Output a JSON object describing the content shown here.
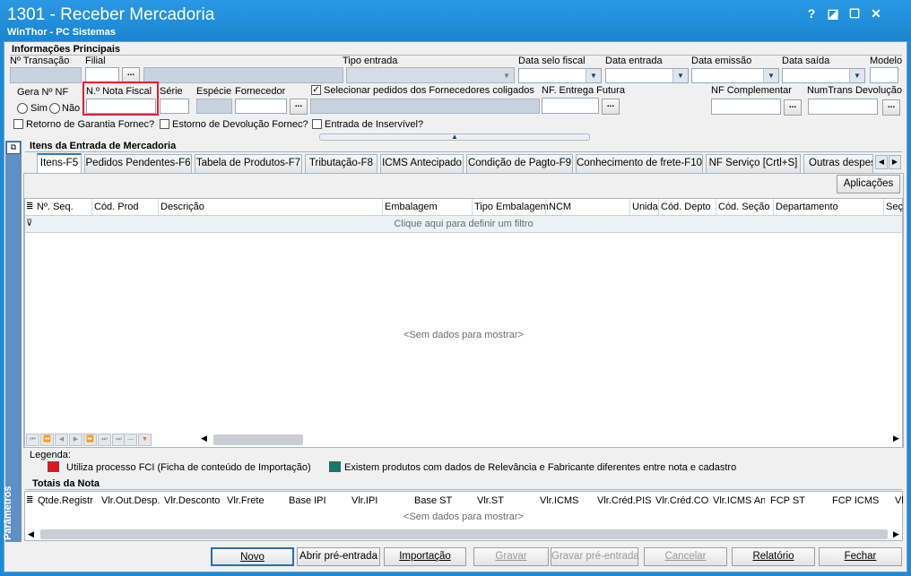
{
  "window": {
    "title": "1301 - Receber Mercadoria",
    "subtitle": "WinThor - PC Sistemas",
    "help": "?",
    "restore": "◪",
    "maximize": "☐",
    "close": "✕"
  },
  "info": {
    "section_title": "Informações Principais",
    "n_transacao": "Nº Transação",
    "filial": "Filial",
    "tipo_entrada": "Tipo entrada",
    "data_selo_fiscal": "Data selo fiscal",
    "data_entrada": "Data entrada",
    "data_emissao": "Data emissão",
    "data_saida": "Data saída",
    "modelo": "Modelo",
    "gera_nf": "Gera Nº NF",
    "sim": "Sim",
    "nao": "Não",
    "nota_fiscal": "N.º Nota Fiscal",
    "serie": "Série",
    "especie": "Espécie",
    "fornecedor": "Fornecedor",
    "selecionar_pedidos": "Selecionar pedidos dos Fornecedores coligados",
    "nf_entrega_futura": "NF. Entrega Futura",
    "nf_complementar": "NF Complementar",
    "numtrans_devolucao": "NumTrans Devolução",
    "retorno_garantia": "Retorno de Garantia Fornec?",
    "estorno_devolucao": "Estorno de Devolução Fornec?",
    "entrada_inservivel": "Entrada de Inservível?",
    "dots": "..."
  },
  "items": {
    "section_title": "Itens da Entrada de Mercadoria",
    "tabs": [
      "Itens-F5",
      "Pedidos Pendentes-F6",
      "Tabela de Produtos-F7",
      "Tributação-F8",
      "ICMS Antecipado",
      "Condição de Pagto-F9",
      "Conhecimento de frete-F10",
      "NF Serviço [Crtl+S]",
      "Outras despes"
    ],
    "aplicacoes": "Aplicações",
    "columns": [
      "Nº. Seq.",
      "Cód. Prod",
      "Descrição",
      "Embalagem",
      "Tipo Embalagem",
      "NCM",
      "Unida",
      "Cód. Depto",
      "Cód. Seção",
      "Departamento",
      "Seç"
    ],
    "filter_hint": "Clique aqui para definir um filtro",
    "empty": "<Sem dados para mostrar>"
  },
  "legend": {
    "title": "Legenda:",
    "fci": "Utiliza processo FCI (Ficha de conteúdo de Importação)",
    "relevancia": "Existem produtos com dados de Relevância e Fabricante diferentes entre nota e cadastro",
    "fci_color": "#e8141c",
    "relevancia_color": "#127a72"
  },
  "totais": {
    "title": "Totais da Nota",
    "columns": [
      "Qtde.Registr",
      "Vlr.Out.Desp.",
      "Vlr.Desconto",
      "Vlr.Frete",
      "Base IPI",
      "Vlr.IPI",
      "Base ST",
      "Vlr.ST",
      "Vlr.ICMS",
      "Vlr.Créd.PIS",
      "Vlr.Créd.CO",
      "Vlr.ICMS An",
      "FCP ST",
      "FCP ICMS",
      "Vl"
    ],
    "empty": "<Sem dados para mostrar>"
  },
  "side": {
    "parametros": "Parâmetros"
  },
  "buttons": {
    "novo": "Novo",
    "abrir_pre_entrada": "Abrir pré-entrada",
    "importacao": "Importação",
    "gravar": "Gravar",
    "gravar_pre_entrada": "Gravar pré-entrada",
    "cancelar": "Cancelar",
    "relatorio": "Relatório",
    "fechar": "Fechar"
  },
  "colors": {
    "titlebar": "#1d8ad6",
    "highlight": "#e3202a",
    "tab_accent": "#1b7fd0"
  }
}
